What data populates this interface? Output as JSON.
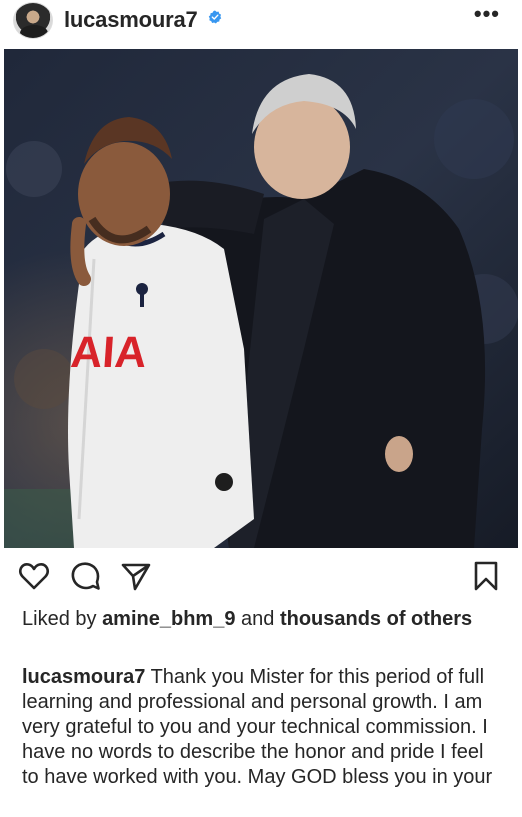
{
  "post": {
    "username": "lucasmoura7",
    "verified_icon": "verified-badge-icon",
    "more_glyph": "•••"
  },
  "image": {
    "jersey_text": "AIA"
  },
  "actions": {
    "icons": [
      "heart-icon",
      "comment-icon",
      "share-icon",
      "bookmark-icon"
    ]
  },
  "likes": {
    "prefix": "Liked by ",
    "user": "amine_bhm_9",
    "middle": " and ",
    "others": "thousands of others"
  },
  "caption": {
    "username": "lucasmoura7",
    "text": "Thank you Mister for this period of full learning and professional and personal growth. I am very grateful to you and your technical commission. I have no words to describe the honor and pride I feel to have worked with you. May GOD bless you in your"
  },
  "colors": {
    "verified": "#3897f0",
    "text": "#262626"
  }
}
